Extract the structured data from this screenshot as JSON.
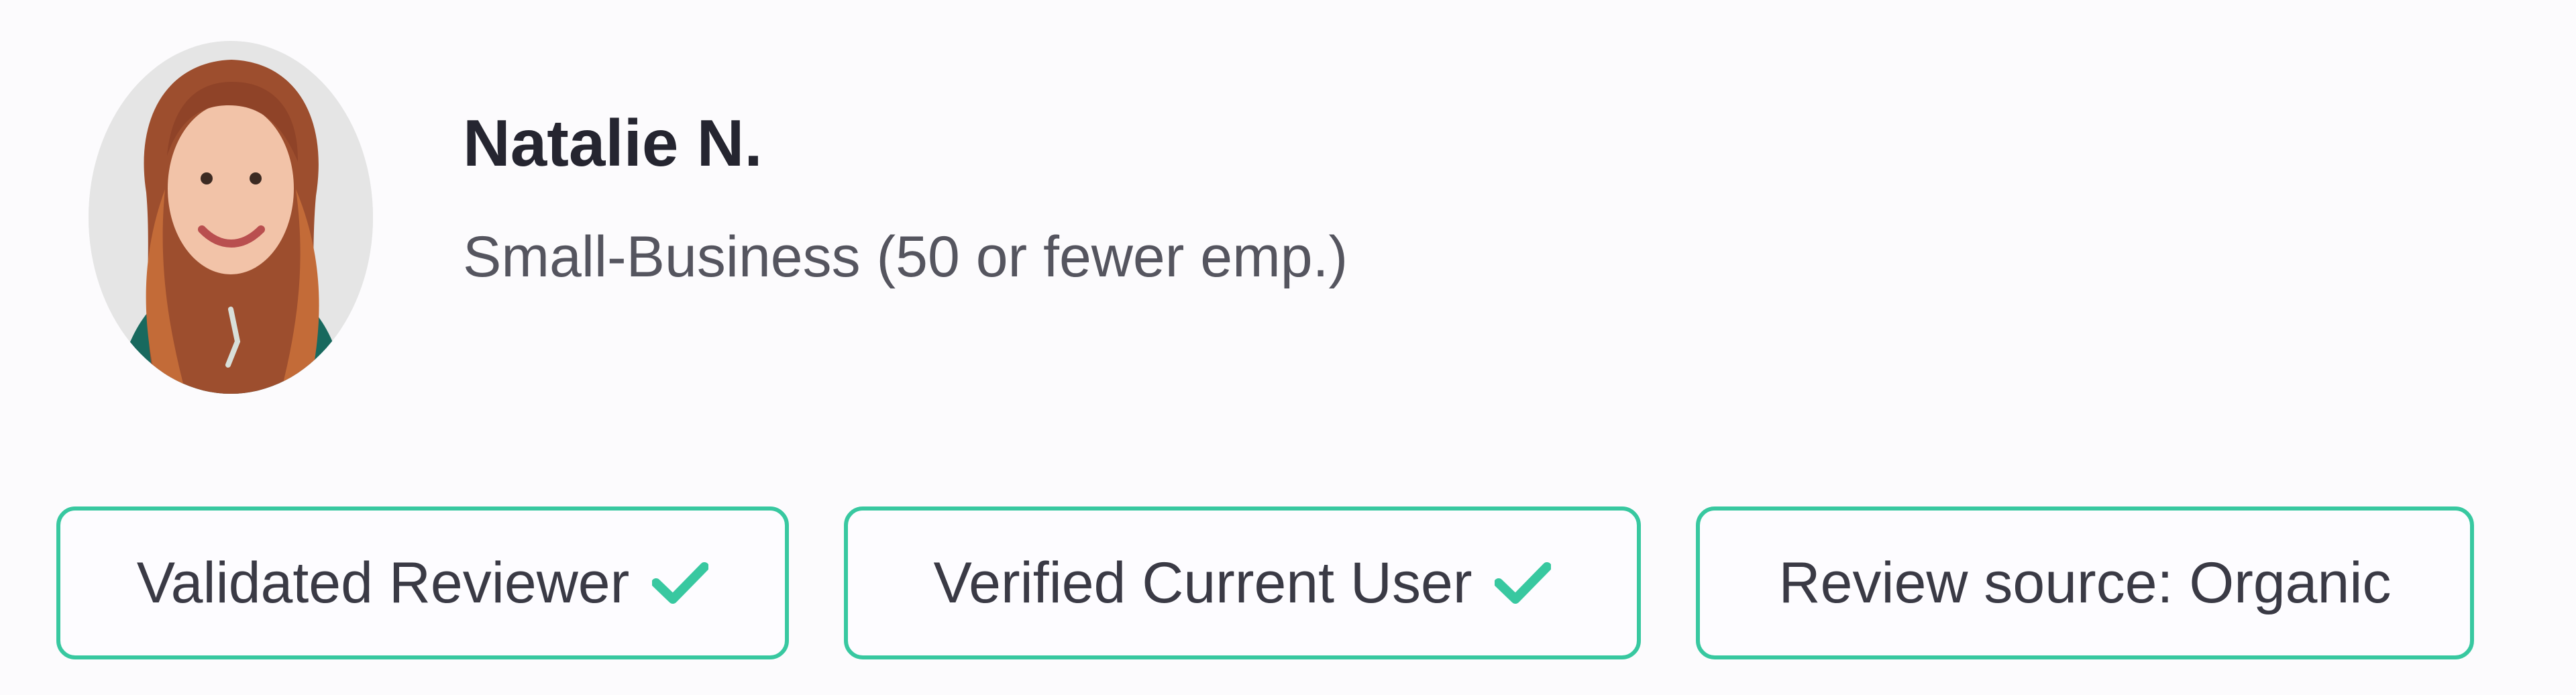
{
  "reviewer": {
    "name": "Natalie N.",
    "segment": "Small-Business (50 or fewer emp.)"
  },
  "badges": [
    {
      "label": "Validated Reviewer",
      "icon": "check-icon"
    },
    {
      "label": "Verified Current User",
      "icon": "check-icon"
    },
    {
      "label": "Review source: Organic"
    }
  ],
  "colors": {
    "accent": "#38c8a0",
    "name_text": "#252530",
    "secondary_text": "#55555f",
    "background": "#fcfbfd"
  }
}
